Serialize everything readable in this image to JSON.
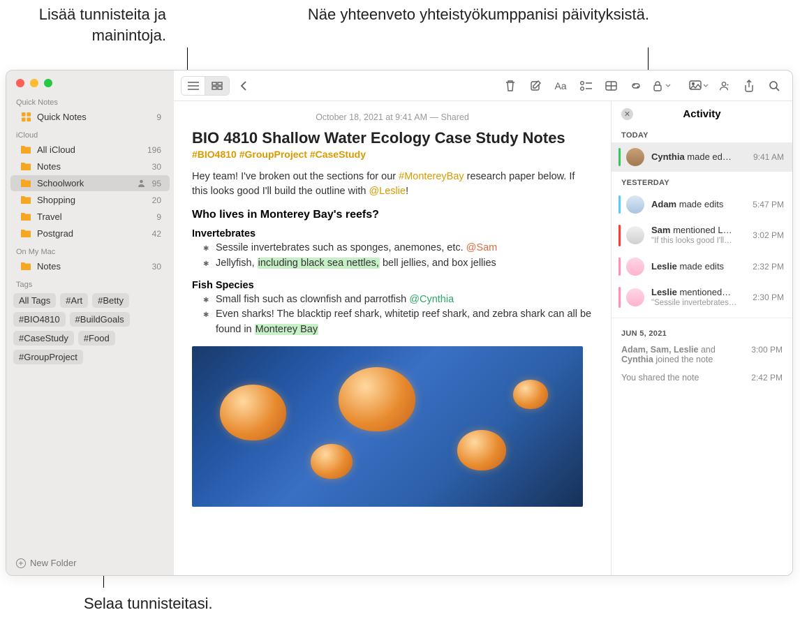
{
  "callouts": {
    "top_left": "Lisää tunnisteita ja mainintoja.",
    "top_right": "Näe yhteenveto yhteistyökumppanisi päivityksistä.",
    "bottom": "Selaa tunnisteitasi."
  },
  "sidebar": {
    "quick_notes_header": "Quick Notes",
    "quick_notes_label": "Quick Notes",
    "quick_notes_count": "9",
    "icloud_header": "iCloud",
    "icloud_items": [
      {
        "label": "All iCloud",
        "count": "196"
      },
      {
        "label": "Notes",
        "count": "30"
      },
      {
        "label": "Schoolwork",
        "count": "95",
        "shared": true,
        "selected": true
      },
      {
        "label": "Shopping",
        "count": "20"
      },
      {
        "label": "Travel",
        "count": "9"
      },
      {
        "label": "Postgrad",
        "count": "42"
      }
    ],
    "onmymac_header": "On My Mac",
    "onmymac_items": [
      {
        "label": "Notes",
        "count": "30"
      }
    ],
    "tags_header": "Tags",
    "tags": [
      "All Tags",
      "#Art",
      "#Betty",
      "#BIO4810",
      "#BuildGoals",
      "#CaseStudy",
      "#Food",
      "#GroupProject"
    ],
    "new_folder": "New Folder"
  },
  "note": {
    "meta": "October 18, 2021 at 9:41 AM — Shared",
    "title": "BIO 4810 Shallow Water Ecology Case Study Notes",
    "hashtags": "#BIO4810 #GroupProject #CaseStudy",
    "intro_a": "Hey team! I've broken out the sections for our ",
    "intro_tag": "#MontereyBay",
    "intro_b": " research paper below. If this looks good I'll build the outline with ",
    "intro_mention": "@Leslie",
    "intro_c": "!",
    "h2": "Who lives in Monterey Bay's reefs?",
    "h3a": "Invertebrates",
    "inv1_a": "Sessile invertebrates such as sponges, anemones, etc. ",
    "inv1_at": "@Sam",
    "inv2_a": "Jellyfish, ",
    "inv2_hl": "including black sea nettles,",
    "inv2_b": " bell jellies, and box jellies",
    "h3b": "Fish Species",
    "fish1_a": "Small fish such as clownfish and parrotfish ",
    "fish1_at": "@Cynthia",
    "fish2_a": "Even sharks! The blacktip reef shark, whitetip reef shark, and zebra shark can all be found in ",
    "fish2_hl": "Monterey Bay"
  },
  "activity": {
    "title": "Activity",
    "today": "TODAY",
    "yesterday": "YESTERDAY",
    "jun5": "JUN 5, 2021",
    "rows": [
      {
        "name": "Cynthia",
        "action": " made ed…",
        "time": "9:41 AM"
      },
      {
        "name": "Adam",
        "action": " made edits",
        "time": "5:47 PM"
      },
      {
        "name": "Sam",
        "action": " mentioned L…",
        "sub": "\"If this looks good I'll…",
        "time": "3:02 PM"
      },
      {
        "name": "Leslie",
        "action": " made edits",
        "time": "2:32 PM"
      },
      {
        "name": "Leslie",
        "action": " mentioned…",
        "sub": "\"Sessile invertebrates…",
        "time": "2:30 PM"
      }
    ],
    "joined_a": "Adam, Sam, Leslie",
    "joined_b": " and ",
    "joined_c": "Cynthia",
    "joined_d": " joined the note",
    "joined_time": "3:00 PM",
    "shared": "You shared the note",
    "shared_time": "2:42 PM"
  }
}
